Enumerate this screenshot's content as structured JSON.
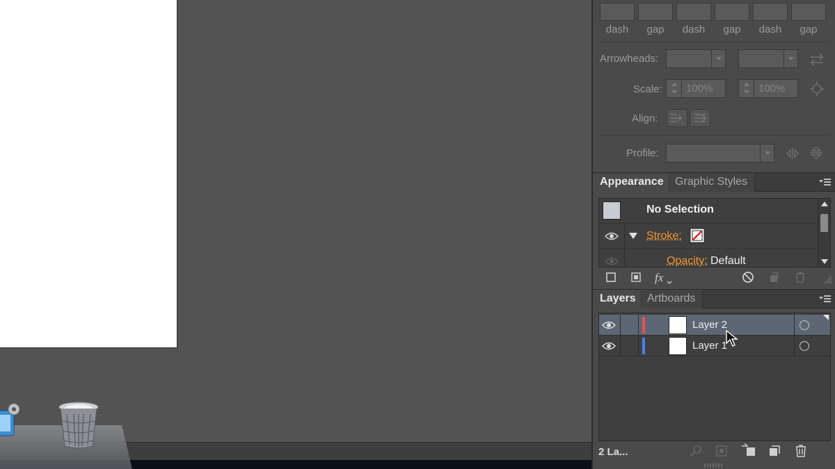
{
  "stroke_panel": {
    "dash_gap_labels": [
      "dash",
      "gap",
      "dash",
      "gap",
      "dash",
      "gap"
    ],
    "arrowheads_label": "Arrowheads:",
    "scale_label": "Scale:",
    "scale_start": "100%",
    "scale_end": "100%",
    "align_label": "Align:",
    "profile_label": "Profile:"
  },
  "appearance_panel": {
    "tabs": [
      "Appearance",
      "Graphic Styles"
    ],
    "selection_label": "No Selection",
    "stroke_label": "Stroke:",
    "opacity_label": "Opacity:",
    "opacity_value": "Default"
  },
  "layers_panel": {
    "tabs": [
      "Layers",
      "Artboards"
    ],
    "layers": [
      {
        "name": "Layer 2",
        "color": "#e8514f",
        "selected": true
      },
      {
        "name": "Layer 1",
        "color": "#4a7ff0",
        "selected": false
      }
    ],
    "footer_count": "2 La..."
  },
  "colors": {
    "accent_orange": "#f39533",
    "panel_bg": "#4a4a4a",
    "canvas_bg": "#535353",
    "selection_row": "#5d6673"
  }
}
